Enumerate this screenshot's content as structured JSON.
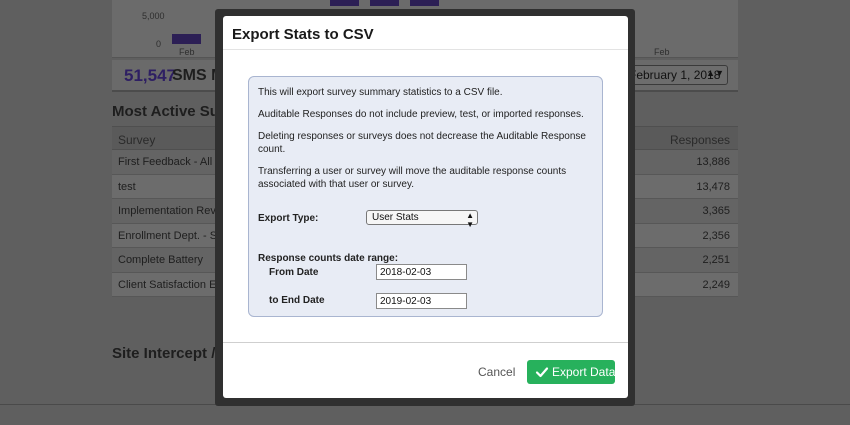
{
  "background": {
    "chart": {
      "y_tick_5000": "5,000",
      "y_tick_0": "0",
      "x_label_left": "Feb",
      "x_label_right": "Feb"
    },
    "stat": {
      "value": "51,547",
      "label": "SMS M"
    },
    "date_select": "February 1, 2018",
    "most_active_heading": "Most Active Surv",
    "table": {
      "header_survey": "Survey",
      "header_responses": "Responses",
      "rows": [
        {
          "name": "First Feedback - All R",
          "responses": "13,886"
        },
        {
          "name": "test",
          "responses": "13,478"
        },
        {
          "name": "Implementation Revie",
          "responses": "3,365"
        },
        {
          "name": "Enrollment Dept. - St",
          "responses": "2,356"
        },
        {
          "name": "Complete Battery",
          "responses": "2,251"
        },
        {
          "name": "Client Satisfaction Ex",
          "responses": "2,249"
        }
      ]
    },
    "site_intercept_heading": "Site Intercept /"
  },
  "modal": {
    "title": "Export Stats to CSV",
    "info": {
      "line1": "This will export survey summary statistics to a CSV file.",
      "line2": "Auditable Responses do not include preview, test, or imported responses.",
      "line3": "Deleting responses or surveys does not decrease the Auditable Response count.",
      "line4": "Transferring a user or survey will move the auditable response counts associated with that user or survey."
    },
    "export_type_label": "Export Type:",
    "export_type_value": "User Stats",
    "date_range_label": "Response counts date range:",
    "from_label": "From Date",
    "from_value": "2018-02-03",
    "to_label": "to End Date",
    "to_value": "2019-02-03",
    "cancel_label": "Cancel",
    "export_label": "Export Data"
  },
  "colors": {
    "accent_green": "#27b15c",
    "stat_purple": "#2e1f63"
  }
}
